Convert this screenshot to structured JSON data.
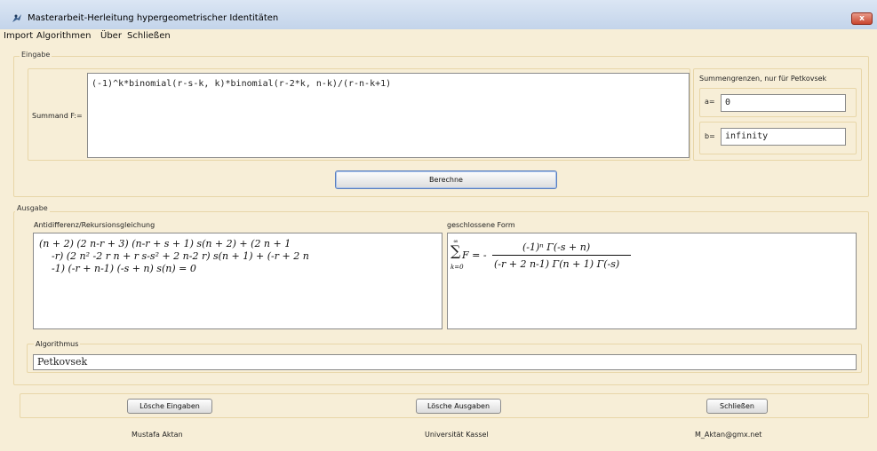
{
  "window": {
    "title": "Masterarbeit-Herleitung hypergeometrischer Identitäten",
    "close_glyph": "x"
  },
  "menu": {
    "items": [
      "Import",
      "Algorithmen",
      "Über",
      "Schließen"
    ]
  },
  "eingabe": {
    "group_title": "Eingabe",
    "summand_label": "Summand F:=",
    "summand_value": "(-1)^k*binomial(r-s-k, k)*binomial(r-2*k, n-k)/(r-n-k+1)",
    "bounds_title": "Summengrenzen, nur für Petkovsek",
    "a_label": "a=",
    "a_value": "0",
    "b_label": "b=",
    "b_value": "infinity",
    "compute_button": "Berechne"
  },
  "ausgabe": {
    "group_title": "Ausgabe",
    "antidiff_title": "Antidifferenz/Rekursionsgleichung",
    "antidiff_lines": [
      "(n + 2) (2 n-r + 3) (n-r + s + 1) s(n + 2) + (2 n + 1",
      "-r) (2 n² -2 r n + r s-s² + 2 n-2 r) s(n + 1) + (-r + 2 n",
      "-1) (-r + n-1) (-s + n) s(n) = 0"
    ],
    "closed_title": "geschlossene Form",
    "closed_form": {
      "sum_upper": "∞",
      "sum_symbol": "∑",
      "sum_lower": "k=0",
      "lhs": "F = -",
      "numerator": "(-1)ⁿ Γ(-s + n)",
      "denominator": "(-r + 2 n-1) Γ(n + 1) Γ(-s)"
    },
    "algorithm_title": "Algorithmus",
    "algorithm_value": "Petkovsek"
  },
  "buttons": {
    "clear_inputs": "Lösche Eingaben",
    "clear_outputs": "Lösche Ausgaben",
    "close": "Schließen"
  },
  "footer": {
    "author": "Mustafa Aktan",
    "university": "Universität Kassel",
    "email": "M_Aktan@gmx.net"
  },
  "colors": {
    "panel_background": "#f7eed7",
    "titlebar": "#c3d4ea",
    "close_button": "#c9452e"
  },
  "icons": {
    "app": "bird-icon"
  }
}
